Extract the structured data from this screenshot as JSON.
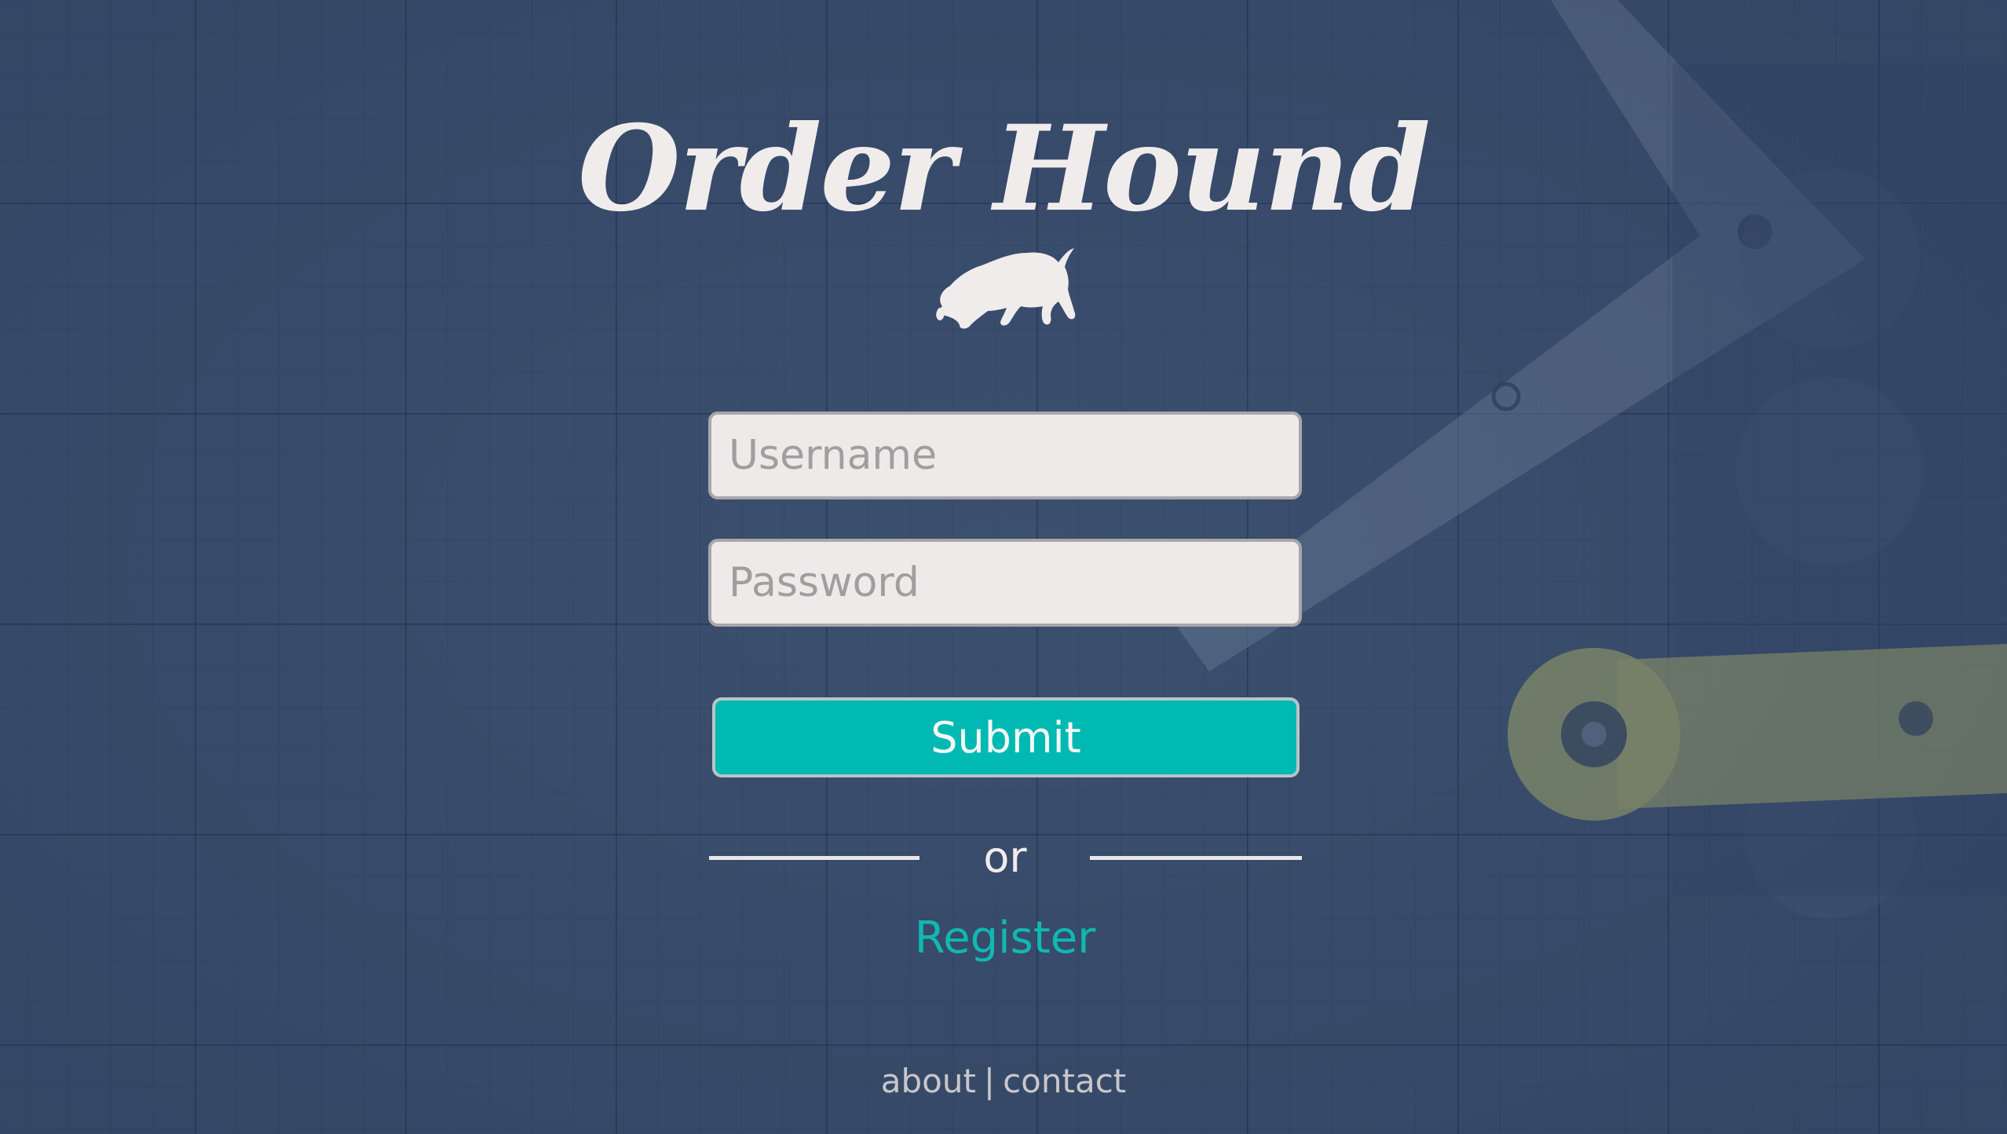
{
  "app": {
    "title": "Order Hound",
    "logo_icon": "sniffing-dog-icon"
  },
  "login_form": {
    "username_placeholder": "Username",
    "username_value": "",
    "password_placeholder": "Password",
    "password_value": "",
    "submit_label": "Submit"
  },
  "divider": {
    "label": "or"
  },
  "register": {
    "label": "Register"
  },
  "footer": {
    "about_label": "about",
    "separator": "|",
    "contact_label": "contact"
  },
  "colors": {
    "background": "#3b4f6f",
    "accent": "#00b9b3",
    "text_light": "#f1ecec",
    "field_background": "#efeaea"
  }
}
